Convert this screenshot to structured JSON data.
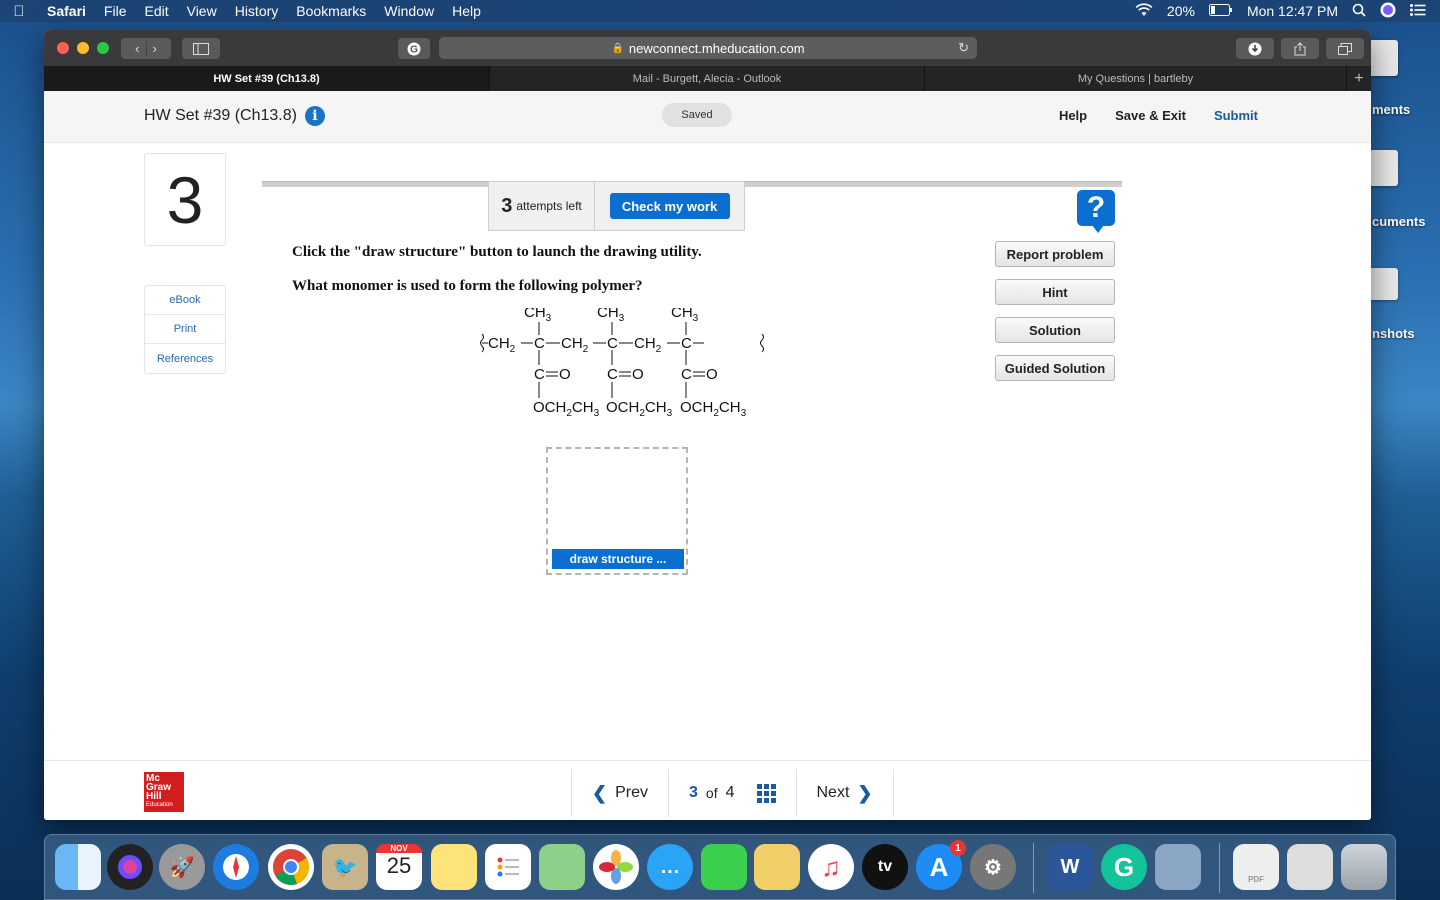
{
  "menubar": {
    "apple": "",
    "items": [
      "Safari",
      "File",
      "Edit",
      "View",
      "History",
      "Bookmarks",
      "Window",
      "Help"
    ],
    "battery": "20%",
    "clock": "Mon 12:47 PM"
  },
  "desktop": {
    "labels": [
      "ments",
      "cuments",
      "nshots"
    ]
  },
  "browser": {
    "url": "newconnect.mheducation.com",
    "tabs": [
      "HW Set #39 (Ch13.8)",
      "Mail - Burgett, Alecia - Outlook",
      "My Questions | bartleby"
    ]
  },
  "header": {
    "title": "HW Set #39 (Ch13.8)",
    "info": "i",
    "saved": "Saved",
    "help": "Help",
    "save_exit": "Save & Exit",
    "submit": "Submit"
  },
  "question": {
    "number": "3",
    "attempts_count": "3",
    "attempts_label": "attempts left",
    "check_button": "Check my work",
    "instruction": "Click the \"draw structure\" button to launch the drawing utility.",
    "prompt": "What monomer is used to form the following polymer?",
    "draw_button": "draw structure ..."
  },
  "sidebar": {
    "links": [
      "eBook",
      "Print",
      "References"
    ]
  },
  "helpers": {
    "help_icon": "?",
    "buttons": [
      "Report problem",
      "Hint",
      "Solution",
      "Guided Solution"
    ]
  },
  "structure": {
    "ch3": "CH",
    "sub3": "3",
    "ch2": "CH",
    "sub2": "2",
    "c": "C",
    "co": "C",
    "o": "O",
    "och": "OCH",
    "ch": "CH"
  },
  "footer": {
    "logo_lines": [
      "Mc",
      "Graw",
      "Hill",
      "Education"
    ],
    "prev": "Prev",
    "current": "3",
    "of": "of",
    "total": "4",
    "next": "Next"
  },
  "dock": {
    "calendar_month": "NOV",
    "calendar_day": "25",
    "appstore_badge": "1",
    "tv_label": "tv",
    "word_label": "W",
    "pdf_label": "PDF"
  },
  "colors": {
    "accent": "#0a6fd1",
    "link": "#2a66b0",
    "brand_red": "#d21e1e"
  }
}
